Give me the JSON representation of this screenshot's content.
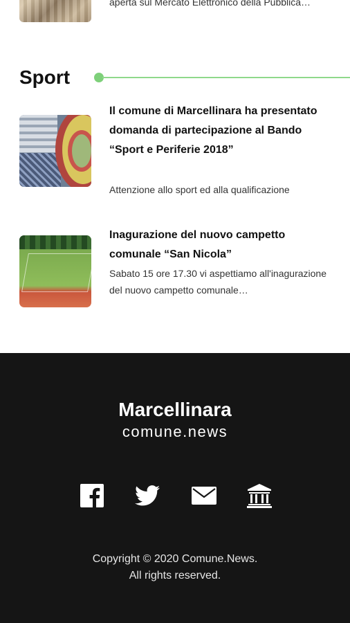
{
  "previous_item": {
    "desc": "aperta sul Mercato Elettronico della Pubblica…"
  },
  "sport_section": {
    "title": "Sport",
    "accent_color": "#7ed07a",
    "items": [
      {
        "title": "Il comune di Marcellinara ha presentato domanda di partecipazione al Bando “Sport e Periferie 2018”",
        "desc": "Attenzione allo sport ed alla qualificazione"
      },
      {
        "title": "Inagurazione del nuovo campetto comunale “San Nicola”",
        "desc": "Sabato 15 ore 17.30 vi aspettiamo all'inagurazione del nuovo campetto comunale…"
      }
    ]
  },
  "footer": {
    "brand": "Marcellinara",
    "subbrand": "comune.news",
    "socials": [
      "facebook-icon",
      "twitter-icon",
      "mail-icon",
      "institution-icon"
    ],
    "copyright_line1": "Copyright © 2020 Comune.News.",
    "copyright_line2": "All rights reserved.",
    "background_color": "#151515"
  }
}
